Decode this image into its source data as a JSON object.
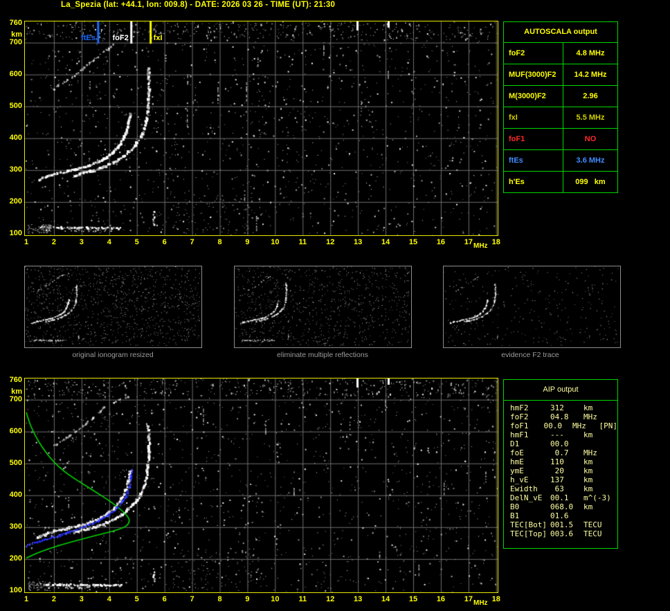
{
  "header": {
    "title": "La_Spezia (lat: +44.1, lon: 009.8) - DATE: 2026 03 26 - TIME (UT): 21:30"
  },
  "axis": {
    "xticks": [
      "1",
      "2",
      "3",
      "4",
      "5",
      "6",
      "7",
      "8",
      "9",
      "10",
      "11",
      "12",
      "13",
      "14",
      "15",
      "16",
      "17",
      "18"
    ],
    "xunit": "MHz",
    "yticks": [
      {
        "label": "760",
        "km": 760
      },
      {
        "label": "km",
        "km": 724
      },
      {
        "label": "700",
        "km": 700
      },
      {
        "label": "600",
        "km": 600
      },
      {
        "label": "500",
        "km": 500
      },
      {
        "label": "400",
        "km": 400
      },
      {
        "label": "300",
        "km": 300
      },
      {
        "label": "200",
        "km": 200
      },
      {
        "label": "100",
        "km": 100
      }
    ]
  },
  "top_plot": {
    "markers": [
      {
        "label": "ftEs",
        "freq": 3.6,
        "color": "#1a6aff"
      },
      {
        "label": "foF2",
        "freq": 4.8,
        "color": "#ffffff"
      },
      {
        "label": "fxI",
        "freq": 5.5,
        "color": "#ffff00"
      }
    ]
  },
  "bottom_plot": {
    "profile_color": "#00d800",
    "profile_points": [
      [
        1.0,
        660
      ],
      [
        1.1,
        630
      ],
      [
        1.25,
        600
      ],
      [
        1.45,
        568
      ],
      [
        1.7,
        535
      ],
      [
        2.0,
        504
      ],
      [
        2.35,
        476
      ],
      [
        2.75,
        452
      ],
      [
        3.15,
        430
      ],
      [
        3.55,
        408
      ],
      [
        3.95,
        386
      ],
      [
        4.3,
        364
      ],
      [
        4.55,
        345
      ],
      [
        4.7,
        330
      ],
      [
        4.74,
        318
      ],
      [
        4.65,
        305
      ],
      [
        4.45,
        296
      ],
      [
        4.15,
        288
      ],
      [
        3.75,
        279
      ],
      [
        3.3,
        269
      ],
      [
        2.85,
        259
      ],
      [
        2.4,
        248
      ],
      [
        1.95,
        236
      ],
      [
        1.55,
        224
      ],
      [
        1.25,
        213
      ],
      [
        1.0,
        203
      ]
    ],
    "restored_color": "#2830ff",
    "restored_points": [
      [
        1.0,
        241
      ],
      [
        1.3,
        250
      ],
      [
        1.6,
        258
      ],
      [
        1.9,
        266
      ],
      [
        2.2,
        274
      ],
      [
        2.5,
        283
      ],
      [
        2.8,
        292
      ],
      [
        3.1,
        301
      ],
      [
        3.4,
        312
      ],
      [
        3.65,
        322
      ],
      [
        3.9,
        334
      ],
      [
        4.1,
        346
      ],
      [
        4.3,
        360
      ],
      [
        4.45,
        376
      ],
      [
        4.58,
        393
      ],
      [
        4.68,
        412
      ],
      [
        4.74,
        430
      ],
      [
        4.78,
        448
      ],
      [
        4.81,
        464
      ],
      [
        4.83,
        478
      ]
    ]
  },
  "ionogram": {
    "freq_range": [
      1,
      18
    ],
    "height_range_km": [
      100,
      760
    ],
    "noise_seed": 11,
    "noise_count": 1500,
    "traces": [
      {
        "name": "multi-hop-echo",
        "d": 0.4,
        "s": 2.2,
        "gray": true,
        "pts": [
          [
            1.95,
            552
          ],
          [
            2.2,
            566
          ],
          [
            2.5,
            582
          ],
          [
            2.8,
            600
          ],
          [
            3.1,
            620
          ],
          [
            3.4,
            642
          ],
          [
            3.65,
            661
          ],
          [
            3.9,
            678
          ],
          [
            4.15,
            692
          ],
          [
            4.45,
            702
          ],
          [
            4.7,
            708
          ]
        ]
      },
      {
        "name": "f2-ordinary",
        "d": 0.92,
        "s": 2.8,
        "pts": [
          [
            1.45,
            268
          ],
          [
            1.75,
            279
          ],
          [
            2.1,
            288
          ],
          [
            2.5,
            296
          ],
          [
            2.9,
            304
          ],
          [
            3.3,
            314
          ],
          [
            3.6,
            325
          ],
          [
            3.9,
            339
          ],
          [
            4.15,
            355
          ],
          [
            4.35,
            374
          ],
          [
            4.5,
            396
          ],
          [
            4.62,
            420
          ],
          [
            4.7,
            445
          ],
          [
            4.75,
            466
          ],
          [
            4.77,
            478
          ]
        ]
      },
      {
        "name": "f2-extraordinary",
        "d": 0.88,
        "s": 2.8,
        "pts": [
          [
            2.75,
            283
          ],
          [
            3.1,
            291
          ],
          [
            3.45,
            299
          ],
          [
            3.8,
            309
          ],
          [
            4.15,
            322
          ],
          [
            4.45,
            338
          ],
          [
            4.7,
            356
          ],
          [
            4.95,
            378
          ],
          [
            5.15,
            403
          ],
          [
            5.28,
            430
          ],
          [
            5.37,
            462
          ],
          [
            5.42,
            500
          ],
          [
            5.44,
            540
          ],
          [
            5.45,
            575
          ],
          [
            5.43,
            605
          ],
          [
            5.41,
            620
          ]
        ]
      },
      {
        "name": "es-layer",
        "d": 0.8,
        "s": 2.2,
        "pts": [
          [
            1.55,
            120
          ],
          [
            2.2,
            119
          ],
          [
            3.0,
            118
          ],
          [
            3.8,
            118
          ],
          [
            4.45,
            117
          ]
        ]
      },
      {
        "name": "es-layer-faint",
        "d": 0.3,
        "s": 1.8,
        "gray": true,
        "pts": [
          [
            1.45,
            111
          ],
          [
            2.4,
            110
          ],
          [
            3.4,
            110
          ],
          [
            4.1,
            109
          ]
        ]
      },
      {
        "name": "vertical-echo",
        "d": 0.85,
        "s": 2.2,
        "pts": [
          [
            5.62,
            128
          ],
          [
            5.62,
            150
          ],
          [
            5.63,
            168
          ]
        ]
      }
    ]
  },
  "thumbnails": {
    "panels": [
      {
        "caption": "original ionogram resized",
        "noise": 1000,
        "mh": 1.0,
        "es": 1.0,
        "seed": 21
      },
      {
        "caption": "eliminate multiple reflections",
        "noise": 820,
        "mh": 0.35,
        "es": 0.9,
        "seed": 22
      },
      {
        "caption": "evidence F2 trace",
        "noise": 300,
        "mh": 0.45,
        "es": 0.0,
        "seed": 23
      }
    ]
  },
  "autoscala": {
    "title": "AUTOSCALA output",
    "border_color": "#00d800",
    "rows": [
      {
        "label": "foF2",
        "value": "4.8 MHz",
        "color": "#ffff00"
      },
      {
        "label": "MUF(3000)F2",
        "value": "14.2 MHz",
        "color": "#ffff00"
      },
      {
        "label": "M(3000)F2",
        "value": "2.96",
        "color": "#ffff00"
      },
      {
        "label": "fxI",
        "value": "5.5 MHz",
        "color": "#d0d000"
      },
      {
        "label": "foF1",
        "value": "NO",
        "color": "#ff2a2a"
      },
      {
        "label": "ftEs",
        "value": "3.6 MHz",
        "color": "#418cff"
      },
      {
        "label": "h'Es",
        "value": "099   km",
        "color": "#ffff00"
      }
    ]
  },
  "aip": {
    "title": "AIP output",
    "text_color": "#ffffa0",
    "rows": [
      {
        "label": "hmF2",
        "value": "312",
        "unit": "km",
        "extra": ""
      },
      {
        "label": "foF2",
        "value": "04.8",
        "unit": "MHz",
        "extra": ""
      },
      {
        "label": "foF1",
        "value": "00.0",
        "unit": "MHz",
        "extra": "[PN]"
      },
      {
        "label": "hmF1",
        "value": "---",
        "unit": "km",
        "extra": ""
      },
      {
        "label": "D1",
        "value": "00.0",
        "unit": "",
        "extra": ""
      },
      {
        "label": "foE",
        "value": " 0.7",
        "unit": "MHz",
        "extra": ""
      },
      {
        "label": "hmE",
        "value": "110",
        "unit": "km",
        "extra": ""
      },
      {
        "label": "ymE",
        "value": " 20",
        "unit": "km",
        "extra": ""
      },
      {
        "label": "h_vE",
        "value": "137",
        "unit": "km",
        "extra": ""
      },
      {
        "label": "Ewidth",
        "value": " 63",
        "unit": "km",
        "extra": ""
      },
      {
        "label": "DelN_vE",
        "value": "00.1",
        "unit": "m^(-3)",
        "extra": ""
      },
      {
        "label": "B0",
        "value": "068.0",
        "unit": "km",
        "extra": ""
      },
      {
        "label": "B1",
        "value": "01.6",
        "unit": "",
        "extra": ""
      },
      {
        "label": "TEC[Bot]",
        "value": "001.5",
        "unit": "TECU",
        "extra": ""
      },
      {
        "label": "TEC[Top]",
        "value": "003.6",
        "unit": "TECU",
        "extra": ""
      }
    ]
  },
  "chart_data": {
    "type": "scatter",
    "title": "Vertical-incidence ionogram, La_Spezia 2026-03-26 21:30 UT",
    "xlabel": "MHz",
    "ylabel": "km",
    "xlim": [
      1,
      18
    ],
    "ylim": [
      100,
      760
    ],
    "scaled_values": {
      "foF2_MHz": 4.8,
      "MUF3000F2_MHz": 14.2,
      "M3000F2": 2.96,
      "fxI_MHz": 5.5,
      "foF1": "NO",
      "ftEs_MHz": 3.6,
      "hEs_km": 99,
      "hmF2_km": 312
    }
  }
}
